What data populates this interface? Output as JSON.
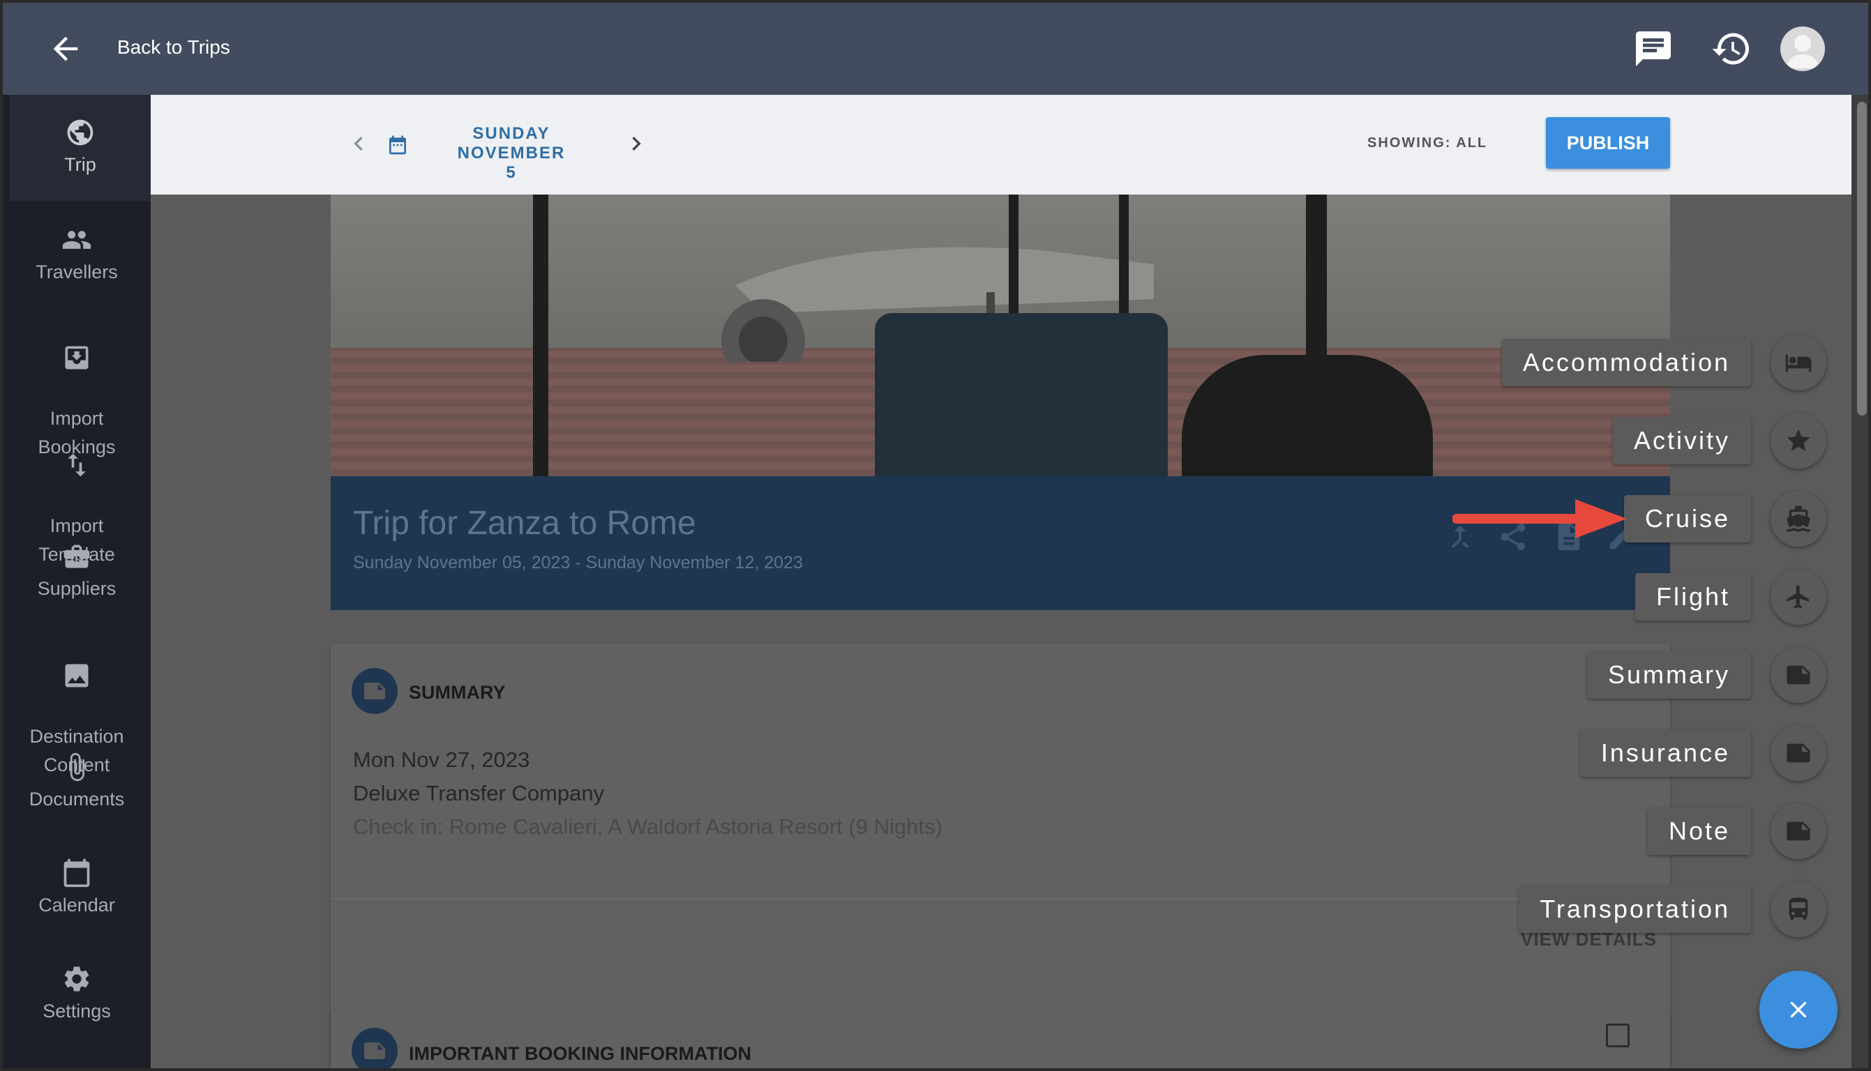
{
  "header": {
    "back_label": "Back to Trips",
    "icons": [
      "back-arrow-icon",
      "chat-icon",
      "history-icon",
      "avatar"
    ]
  },
  "sidebar": {
    "items": [
      {
        "label": "Trip",
        "icon": "globe-icon"
      },
      {
        "label": "Travellers",
        "icon": "people-icon"
      },
      {
        "label": "Import\nBookings",
        "icon": "import-icon"
      },
      {
        "label": "Import\nTemplate",
        "icon": "swap-vertical-icon"
      },
      {
        "label": "Suppliers",
        "icon": "briefcase-icon"
      },
      {
        "label": "Destination\nContent",
        "icon": "image-icon"
      },
      {
        "label": "Documents",
        "icon": "paperclip-icon"
      },
      {
        "label": "Calendar",
        "icon": "calendar-icon"
      },
      {
        "label": "Settings",
        "icon": "gear-icon"
      }
    ]
  },
  "datebar": {
    "date_line1": "SUNDAY NOVEMBER",
    "date_line2": "5",
    "showing": "SHOWING: ALL",
    "publish": "PUBLISH"
  },
  "trip": {
    "title": "Trip for Zanza to Rome",
    "dates": "Sunday November 05, 2023 - Sunday November 12, 2023"
  },
  "summary_card": {
    "heading": "SUMMARY",
    "date": "Mon Nov 27, 2023",
    "company": "Deluxe Transfer Company",
    "checkin": "Check in: Rome Cavalieri, A Waldorf Astoria Resort (9 Nights)",
    "view_details": "VIEW DETAILS"
  },
  "booking_card": {
    "heading": "IMPORTANT BOOKING INFORMATION"
  },
  "speed_dial": {
    "items": [
      {
        "label": "Accommodation",
        "icon": "bed-icon"
      },
      {
        "label": "Activity",
        "icon": "star-icon"
      },
      {
        "label": "Cruise",
        "icon": "ship-icon"
      },
      {
        "label": "Flight",
        "icon": "airplane-icon"
      },
      {
        "label": "Summary",
        "icon": "note-icon"
      },
      {
        "label": "Insurance",
        "icon": "note-icon"
      },
      {
        "label": "Note",
        "icon": "note-icon"
      },
      {
        "label": "Transportation",
        "icon": "bus-icon"
      }
    ],
    "close_icon": "close-icon"
  },
  "colors": {
    "topbar": "#434b5e",
    "sidebar": "#1c1f27",
    "accent": "#3b8fde",
    "callout_arrow": "#e8493d"
  }
}
